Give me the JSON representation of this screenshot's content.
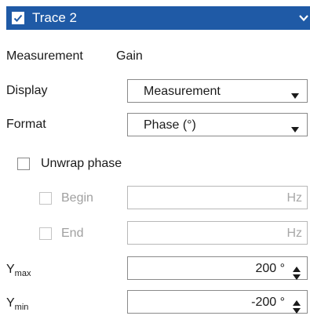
{
  "header": {
    "title": "Trace 2",
    "checked": true,
    "color": "#1f5aa6"
  },
  "measurement": {
    "label": "Measurement",
    "value": "Gain"
  },
  "display": {
    "label": "Display",
    "selected": "Measurement"
  },
  "format": {
    "label": "Format",
    "selected": "Phase (°)"
  },
  "unwrap": {
    "label": "Unwrap phase",
    "checked": false
  },
  "begin": {
    "label": "Begin",
    "unit": "Hz",
    "value": ""
  },
  "end": {
    "label": "End",
    "unit": "Hz",
    "value": ""
  },
  "ymax": {
    "label_main": "Y",
    "label_sub": "max",
    "value": "200 °"
  },
  "ymin": {
    "label_main": "Y",
    "label_sub": "min",
    "value": "-200 °"
  },
  "icons": {
    "header_check": "checkmark-icon",
    "header_chevron": "chevron-down-icon",
    "dropdown_arrow": "triangle-down-icon",
    "spin_up": "triangle-up-icon",
    "spin_down": "triangle-down-icon"
  }
}
